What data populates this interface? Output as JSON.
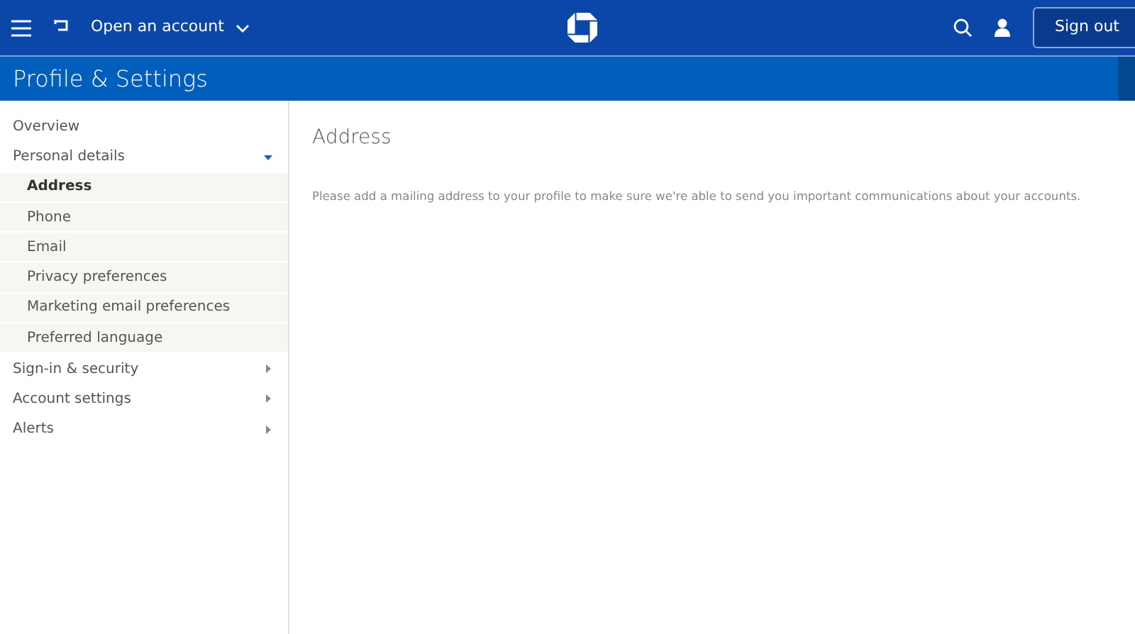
{
  "header": {
    "open_account": "Open an account",
    "sign_out": "Sign out"
  },
  "page_title": "Profile & Settings",
  "sidebar": {
    "items": [
      {
        "label": "Overview",
        "selected": false
      },
      {
        "label": "Personal details",
        "selected": false,
        "expanded": true,
        "children": [
          {
            "label": "Address",
            "selected": true
          },
          {
            "label": "Phone",
            "selected": false
          },
          {
            "label": "Email",
            "selected": false
          },
          {
            "label": "Privacy preferences",
            "selected": false
          },
          {
            "label": "Marketing email preferences",
            "selected": false
          },
          {
            "label": "Preferred language",
            "selected": false
          }
        ]
      },
      {
        "label": "Sign-in & security",
        "selected": false,
        "expanded": false
      },
      {
        "label": "Account settings",
        "selected": false,
        "expanded": false
      },
      {
        "label": "Alerts",
        "selected": false,
        "expanded": false
      }
    ]
  },
  "content": {
    "heading": "Address",
    "message": "Please add a mailing address to your profile to make sure we're able to send you important communications about your accounts."
  }
}
